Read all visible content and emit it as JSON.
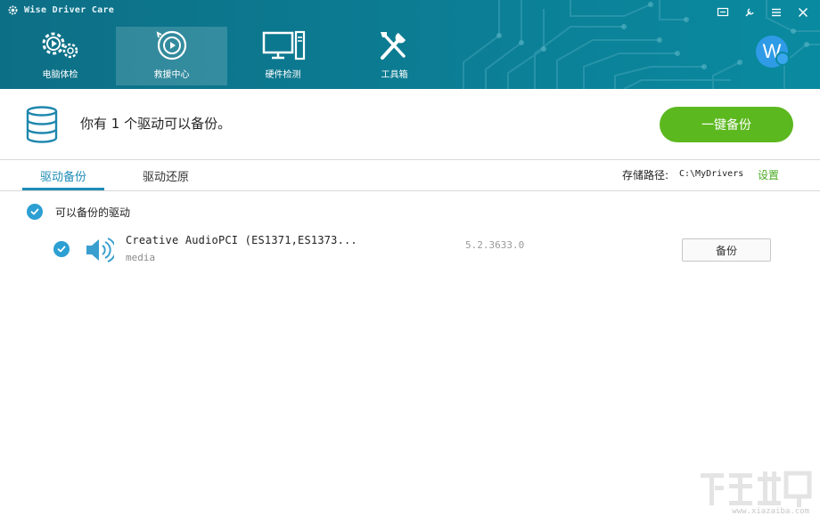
{
  "app": {
    "title": "Wise Driver Care"
  },
  "window_controls": [
    {
      "name": "feedback-icon"
    },
    {
      "name": "skin-icon"
    },
    {
      "name": "menu-icon"
    },
    {
      "name": "close-icon"
    }
  ],
  "nav": {
    "items": [
      {
        "label": "电脑体检",
        "icon": "gear-scan-icon"
      },
      {
        "label": "救援中心",
        "icon": "rescue-icon",
        "active": true
      },
      {
        "label": "硬件检测",
        "icon": "monitor-icon"
      },
      {
        "label": "工具箱",
        "icon": "tools-icon"
      }
    ]
  },
  "user": {
    "avatar_letter": "W"
  },
  "summary": {
    "text": "你有 1 个驱动可以备份。",
    "primary_button": "一键备份"
  },
  "tabs": {
    "backup": "驱动备份",
    "restore": "驱动还原",
    "active": "backup"
  },
  "storage": {
    "label": "存储路径:",
    "path": "C:\\MyDrivers",
    "setting": "设置"
  },
  "list": {
    "group_label": "可以备份的驱动",
    "drivers": [
      {
        "name": "Creative AudioPCI (ES1371,ES1373...",
        "type": "media",
        "version": "5.2.3633.0",
        "action": "备份"
      }
    ]
  },
  "watermark": {
    "site": "www.xiazaiba.com"
  },
  "colors": {
    "header": "#0c7b92",
    "accent_blue": "#1f8db6",
    "check_blue": "#2c9fd3",
    "primary_green": "#5cb81f",
    "link_green": "#4aab23"
  }
}
